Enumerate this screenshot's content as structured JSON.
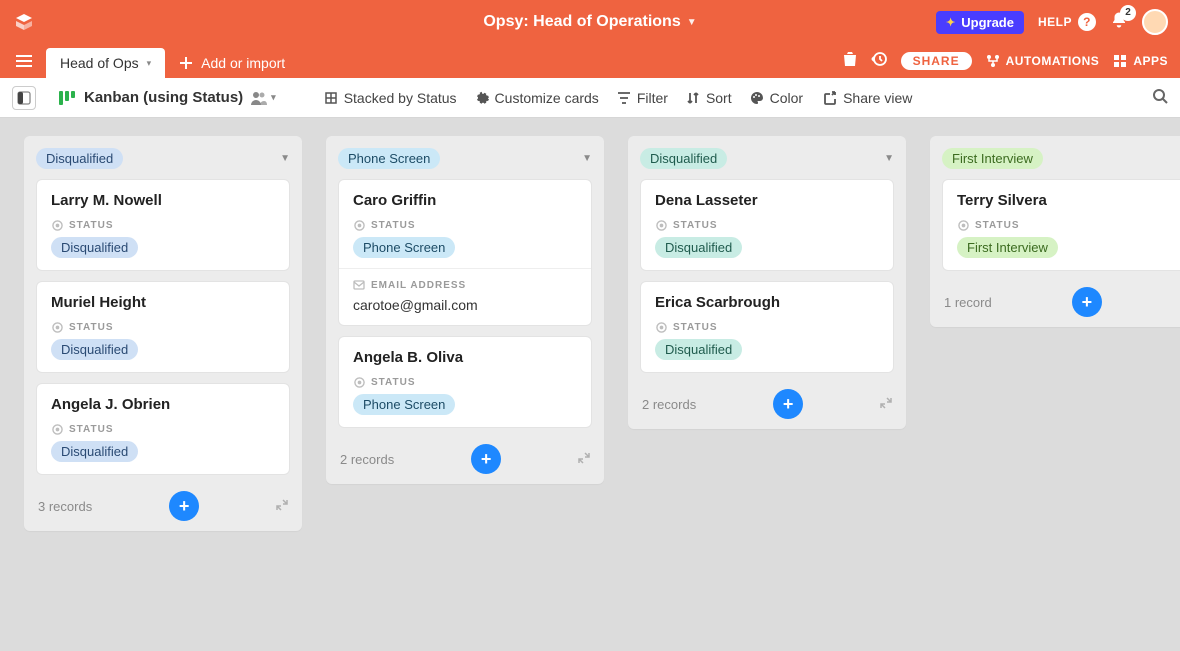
{
  "header": {
    "title": "Opsy: Head of Operations",
    "upgrade_label": "Upgrade",
    "help_label": "HELP",
    "notification_count": "2"
  },
  "tabs": {
    "active_tab": "Head of Ops",
    "add_import_label": "Add or import",
    "share_label": "SHARE",
    "automations_label": "AUTOMATIONS",
    "apps_label": "APPS"
  },
  "viewbar": {
    "view_name": "Kanban (using Status)",
    "stacked_label": "Stacked by Status",
    "customize_label": "Customize cards",
    "filter_label": "Filter",
    "sort_label": "Sort",
    "color_label": "Color",
    "share_view_label": "Share view"
  },
  "field_labels": {
    "status": "STATUS",
    "email": "EMAIL ADDRESS"
  },
  "columns": [
    {
      "name": "Disqualified",
      "pill_class": "pill-blue",
      "footer": "3 records",
      "cards": [
        {
          "title": "Larry M. Nowell",
          "status": "Disqualified",
          "status_class": "pill-blue"
        },
        {
          "title": "Muriel Height",
          "status": "Disqualified",
          "status_class": "pill-blue"
        },
        {
          "title": "Angela J. Obrien",
          "status": "Disqualified",
          "status_class": "pill-blue"
        }
      ]
    },
    {
      "name": "Phone Screen",
      "pill_class": "pill-skyblue",
      "footer": "2 records",
      "cards": [
        {
          "title": "Caro Griffin",
          "status": "Phone Screen",
          "status_class": "pill-skyblue",
          "email": "carotoe@gmail.com"
        },
        {
          "title": "Angela B. Oliva",
          "status": "Phone Screen",
          "status_class": "pill-skyblue"
        }
      ]
    },
    {
      "name": "Disqualified",
      "pill_class": "pill-teal",
      "footer": "2 records",
      "cards": [
        {
          "title": "Dena Lasseter",
          "status": "Disqualified",
          "status_class": "pill-teal"
        },
        {
          "title": "Erica Scarbrough",
          "status": "Disqualified",
          "status_class": "pill-teal"
        }
      ]
    },
    {
      "name": "First Interview",
      "pill_class": "pill-green",
      "footer": "1 record",
      "cards": [
        {
          "title": "Terry Silvera",
          "status": "First Interview",
          "status_class": "pill-green"
        }
      ]
    }
  ]
}
